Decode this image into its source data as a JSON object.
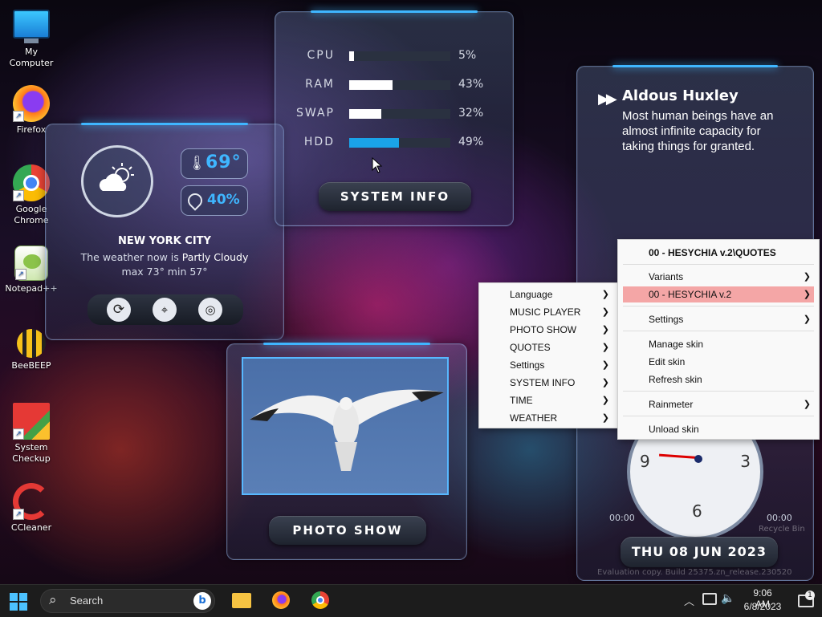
{
  "desktop": {
    "icons": [
      {
        "label": "My Computer"
      },
      {
        "label": "Firefox"
      },
      {
        "label": "Google Chrome"
      },
      {
        "label": "Notepad++"
      },
      {
        "label": "BeeBEEP"
      },
      {
        "label": "System Checkup"
      },
      {
        "label": "CCleaner"
      }
    ]
  },
  "weather": {
    "temperature": "69°",
    "humidity": "40%",
    "city": "NEW YORK CITY",
    "summary_prefix": "The weather now is ",
    "condition": "Partly Cloudy",
    "range": "max 73° min 57°"
  },
  "system_info": {
    "rows": [
      {
        "label": "CPU",
        "value": "5%",
        "percent": 5,
        "color": "#ffffff"
      },
      {
        "label": "RAM",
        "value": "43%",
        "percent": 43,
        "color": "#ffffff"
      },
      {
        "label": "SWAP",
        "value": "32%",
        "percent": 32,
        "color": "#ffffff"
      },
      {
        "label": "HDD",
        "value": "49%",
        "percent": 49,
        "color": "#1aa3e8"
      }
    ],
    "title": "SYSTEM INFO"
  },
  "quote": {
    "author": "Aldous Huxley",
    "text": "Most human beings have an almost infinite capacity for taking things for granted."
  },
  "photo_show": {
    "title": "PHOTO SHOW"
  },
  "clock": {
    "num_9": "9",
    "num_3": "3",
    "num_6": "6",
    "time_left": "00:00",
    "time_right": "00:00",
    "date": "THU 08 JUN 2023"
  },
  "watermark": "Evaluation copy. Build 25375.zn_release.230520",
  "recycle_bin_label": "Recycle Bin",
  "skin_menu": {
    "items": [
      {
        "label": "Language"
      },
      {
        "label": "MUSIC PLAYER"
      },
      {
        "label": "PHOTO SHOW"
      },
      {
        "label": "QUOTES"
      },
      {
        "label": "Settings"
      },
      {
        "label": "SYSTEM INFO"
      },
      {
        "label": "TIME"
      },
      {
        "label": "WEATHER"
      }
    ]
  },
  "context_menu": {
    "header": "00 - HESYCHIA v.2\\QUOTES",
    "variants": "Variants",
    "highlighted": "00 - HESYCHIA v.2",
    "settings": "Settings",
    "manage_skin": "Manage skin",
    "edit_skin": "Edit skin",
    "refresh_skin": "Refresh skin",
    "rainmeter": "Rainmeter",
    "unload_skin": "Unload skin"
  },
  "taskbar": {
    "search_placeholder": "Search",
    "time": "9:06 AM",
    "date": "6/8/2023",
    "notification_count": "1"
  },
  "colors": {
    "accent": "#3fb6ff",
    "highlight": "#f4a6a6"
  }
}
